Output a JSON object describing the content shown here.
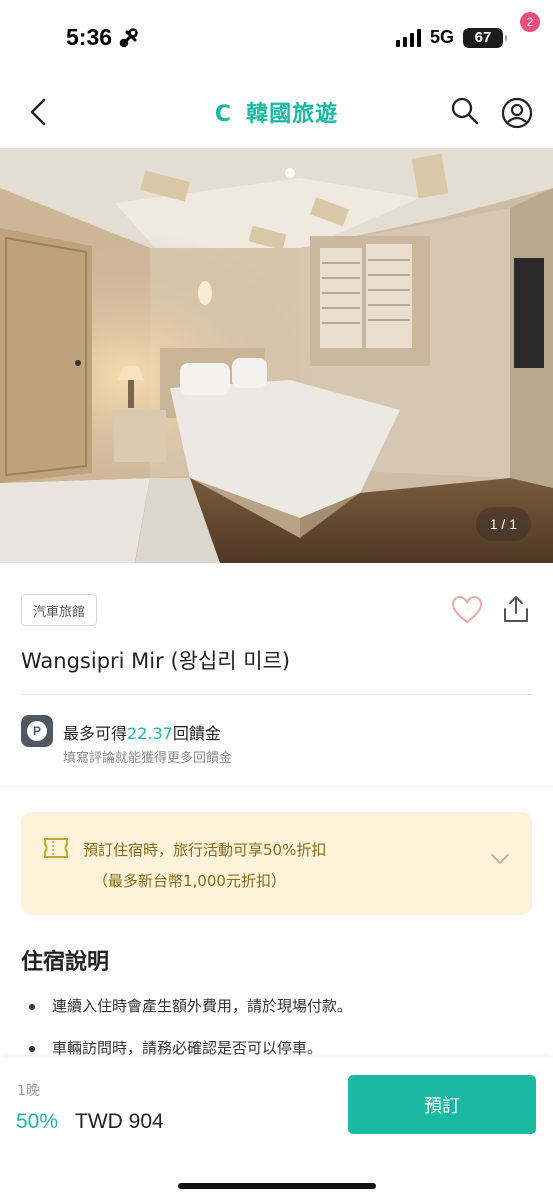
{
  "status_bar": {
    "time": "5:36",
    "network": "5G",
    "battery": "67"
  },
  "nav": {
    "title": "韓國旅遊",
    "logo": "C",
    "notification_count": "2"
  },
  "gallery": {
    "counter": "1 / 1"
  },
  "hotel": {
    "category": "汽車旅館",
    "name": "Wangsipri Mir (왕십리 미르)"
  },
  "points": {
    "prefix": "最多可得",
    "amount": "22.37",
    "suffix": "回饋金",
    "sub": "填寫評論就能獲得更多回饋金"
  },
  "promo": {
    "line1": "預訂住宿時，旅行活動可享50%折扣",
    "line2": "（最多新台幣1,000元折扣）"
  },
  "info": {
    "title": "住宿說明",
    "notes": [
      "連續入住時會產生額外費用，請於現場付款。",
      "車輛訪問時，請務必確認是否可以停車。"
    ]
  },
  "booking": {
    "nights": "1晚",
    "discount": "50%",
    "price": "TWD 904",
    "button": "預訂"
  },
  "colors": {
    "accent": "#1bb9a4",
    "badge": "#ee4c7a",
    "promo_bg": "#fdf3da",
    "promo_text": "#8a6a1a",
    "heart": "#f0a7a7"
  },
  "icons": [
    "back-icon",
    "search-icon",
    "profile-icon",
    "heart-icon",
    "share-icon",
    "points-icon",
    "ticket-icon",
    "chevron-down-icon"
  ]
}
